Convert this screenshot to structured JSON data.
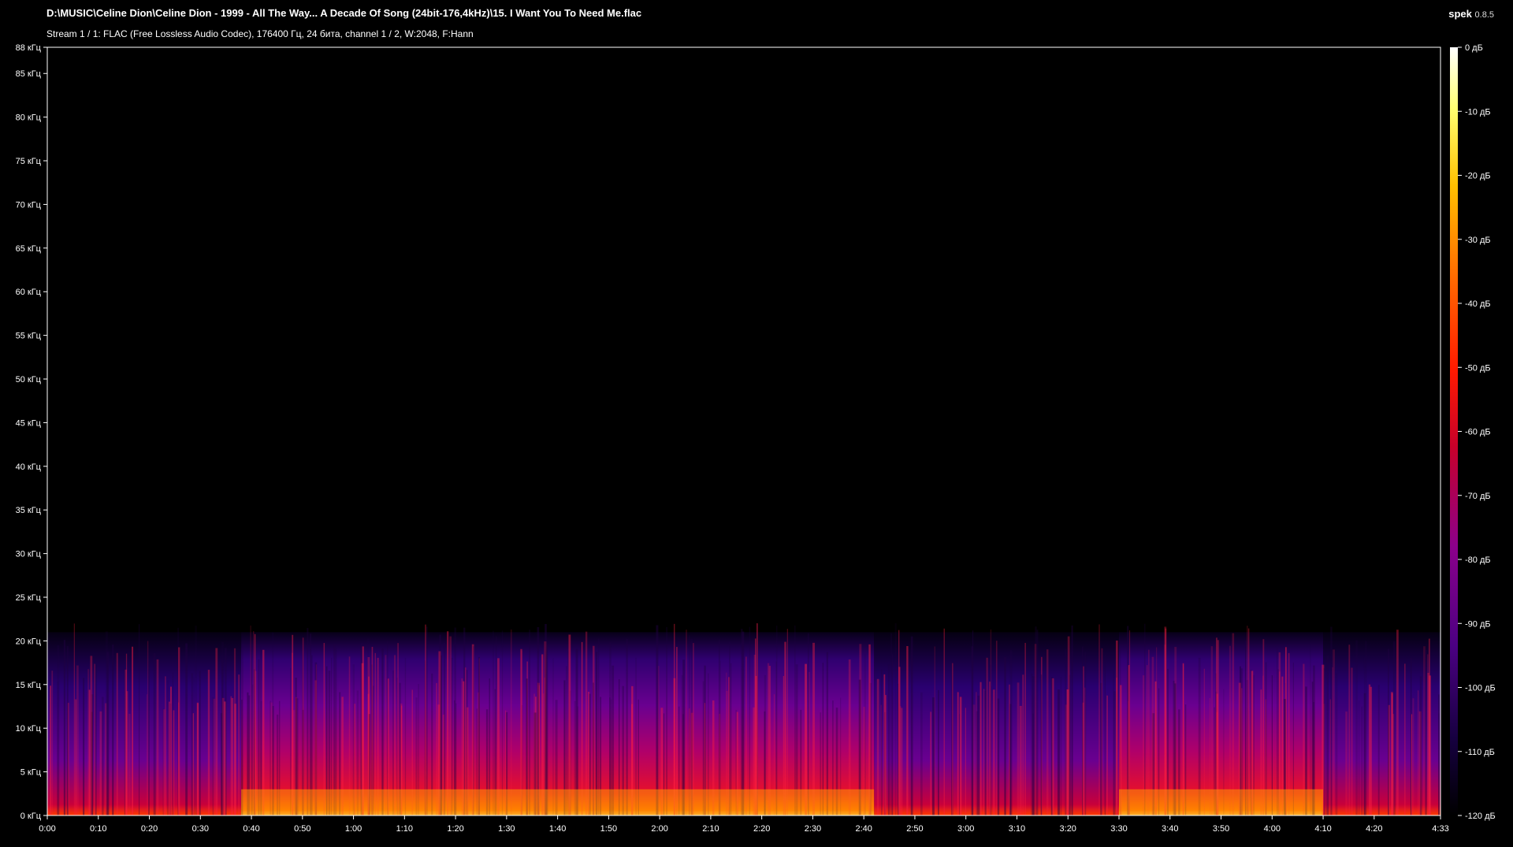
{
  "header": {
    "title": "D:\\MUSIC\\Celine Dion\\Celine Dion - 1999 - All The Way... A Decade Of Song (24bit-176,4kHz)\\15. I Want You To Need Me.flac",
    "subtitle": "Stream 1 / 1: FLAC (Free Lossless Audio Codec), 176400 Гц, 24 бита, channel 1 / 2, W:2048, F:Hann",
    "app_name": "spek",
    "app_version": "0.8.5"
  },
  "chart_data": {
    "type": "heatmap",
    "title": "",
    "xlabel": "",
    "ylabel": "",
    "duration_seconds": 273,
    "x_ticks": [
      "0:00",
      "0:10",
      "0:20",
      "0:30",
      "0:40",
      "0:50",
      "1:00",
      "1:10",
      "1:20",
      "1:30",
      "1:40",
      "1:50",
      "2:00",
      "2:10",
      "2:20",
      "2:30",
      "2:40",
      "2:50",
      "3:00",
      "3:10",
      "3:20",
      "3:30",
      "3:40",
      "3:50",
      "4:00",
      "4:10",
      "4:20",
      "4:33"
    ],
    "x_tick_seconds": [
      0,
      10,
      20,
      30,
      40,
      50,
      60,
      70,
      80,
      90,
      100,
      110,
      120,
      130,
      140,
      150,
      160,
      170,
      180,
      190,
      200,
      210,
      220,
      230,
      240,
      250,
      260,
      273
    ],
    "ylim": [
      0,
      88
    ],
    "y_ticks": [
      0,
      5,
      10,
      15,
      20,
      25,
      30,
      35,
      40,
      45,
      50,
      55,
      60,
      65,
      70,
      75,
      80,
      85,
      88
    ],
    "y_tick_labels": [
      "0 кГц",
      "5 кГц",
      "10 кГц",
      "15 кГц",
      "20 кГц",
      "25 кГц",
      "30 кГц",
      "35 кГц",
      "40 кГц",
      "45 кГц",
      "50 кГц",
      "55 кГц",
      "60 кГц",
      "65 кГц",
      "70 кГц",
      "75 кГц",
      "80 кГц",
      "85 кГц",
      "88 кГц"
    ],
    "content_cutoff_khz": 21,
    "colorbar": {
      "range_db": [
        -120,
        0
      ],
      "ticks": [
        0,
        -10,
        -20,
        -30,
        -40,
        -50,
        -60,
        -70,
        -80,
        -90,
        -100,
        -110,
        -120
      ],
      "tick_labels": [
        "0 дБ",
        "-10 дБ",
        "-20 дБ",
        "-30 дБ",
        "-40 дБ",
        "-50 дБ",
        "-60 дБ",
        "-70 дБ",
        "-80 дБ",
        "-90 дБ",
        "-100 дБ",
        "-110 дБ",
        "-120 дБ"
      ],
      "colors": [
        "#000000",
        "#1a0050",
        "#4b0082",
        "#8b008b",
        "#c8002a",
        "#ff2000",
        "#ff7000",
        "#ffc000",
        "#ffff60",
        "#ffffff"
      ]
    },
    "quiet_segments_seconds": [
      [
        0,
        38
      ],
      [
        162,
        210
      ],
      [
        250,
        273
      ]
    ],
    "loud_segments_seconds": [
      [
        38,
        162
      ],
      [
        210,
        250
      ]
    ]
  }
}
